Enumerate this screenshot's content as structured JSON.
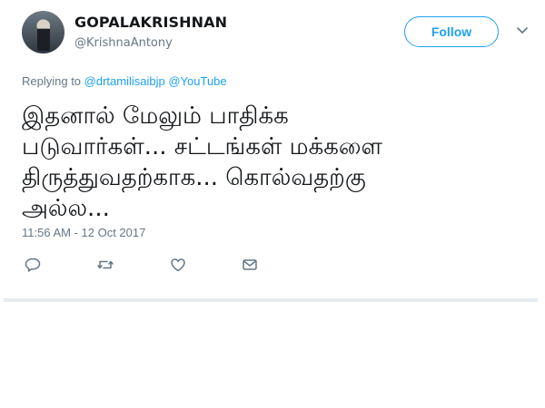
{
  "user": {
    "display_name": "GOPALAKRISHNAN",
    "handle": "@KrishnaAntony"
  },
  "follow_label": "Follow",
  "reply_to": {
    "prefix": "Replying to",
    "mentions": [
      "@drtamilisaibjp",
      "@YouTube"
    ]
  },
  "tweet": {
    "lines": [
      "இதனால் மேலும் பாதிக்க",
      "படுவார்கள்... சட்டங்கள் மக்களை",
      "திருத்துவதற்காக... கொல்வதற்கு",
      "அல்ல..."
    ],
    "timestamp": "11:56 AM - 12 Oct 2017"
  },
  "icons": [
    "avatar",
    "chevron-down-icon",
    "reply-icon",
    "retweet-icon",
    "like-icon",
    "message-icon"
  ],
  "colors": {
    "accent": "#1da1f2",
    "muted": "#657786",
    "text": "#14171a",
    "divider": "#e6ecf0"
  }
}
